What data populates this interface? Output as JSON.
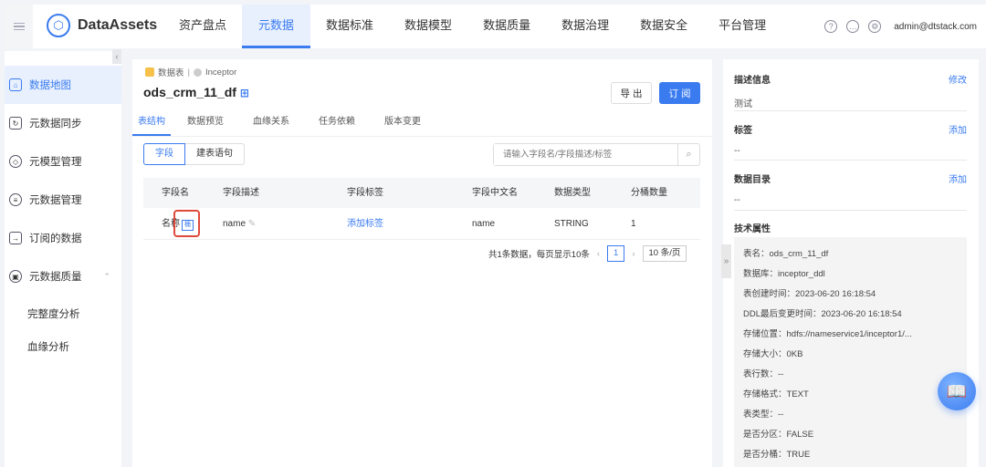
{
  "header": {
    "brand": "DataAssets",
    "nav": [
      "资产盘点",
      "元数据",
      "数据标准",
      "数据模型",
      "数据质量",
      "数据治理",
      "数据安全",
      "平台管理"
    ],
    "user": "admin@dtstack.com"
  },
  "sidebar": {
    "items": [
      {
        "label": "数据地图"
      },
      {
        "label": "元数据同步"
      },
      {
        "label": "元模型管理"
      },
      {
        "label": "元数据管理"
      },
      {
        "label": "订阅的数据"
      },
      {
        "label": "元数据质量"
      },
      {
        "label": "完整度分析"
      },
      {
        "label": "血缘分析"
      }
    ]
  },
  "main": {
    "crumb_type": "数据表",
    "crumb_source": "Inceptor",
    "title": "ods_crm_11_df",
    "export": "导 出",
    "subscribe": "订 阅",
    "tabs": [
      "表结构",
      "数据预览",
      "血缘关系",
      "任务依赖",
      "版本变更"
    ],
    "seg": [
      "字段",
      "建表语句"
    ],
    "search_placeholder": "请输入字段名/字段描述/标签",
    "columns": [
      "字段名",
      "字段描述",
      "字段标签",
      "字段中文名",
      "数据类型",
      "分桶数量"
    ],
    "rows": [
      {
        "name": "名称",
        "tag": "桶",
        "desc": "name",
        "label": "添加标签",
        "cn": "name",
        "type": "STRING",
        "buckets": "1"
      }
    ],
    "pager": {
      "summary": "共1条数据，每页显示10条",
      "page": "1",
      "size": "10 条/页"
    }
  },
  "right": {
    "desc_title": "描述信息",
    "desc_action": "修改",
    "desc_value": "测试",
    "tag_title": "标签",
    "tag_action": "添加",
    "tag_value": "--",
    "catalog_title": "数据目录",
    "catalog_action": "添加",
    "catalog_value": "--",
    "tech_title": "技术属性",
    "tech": [
      "表名：ods_crm_11_df",
      "数据库：inceptor_ddl",
      "表创建时间：2023-06-20 16:18:54",
      "DDL最后变更时间：2023-06-20 16:18:54",
      "存储位置：hdfs://nameservice1/inceptor1/...",
      "存储大小：0KB",
      "表行数：--",
      "存储格式：TEXT",
      "表类型：--",
      "是否分区：FALSE",
      "是否分桶：TRUE"
    ]
  }
}
